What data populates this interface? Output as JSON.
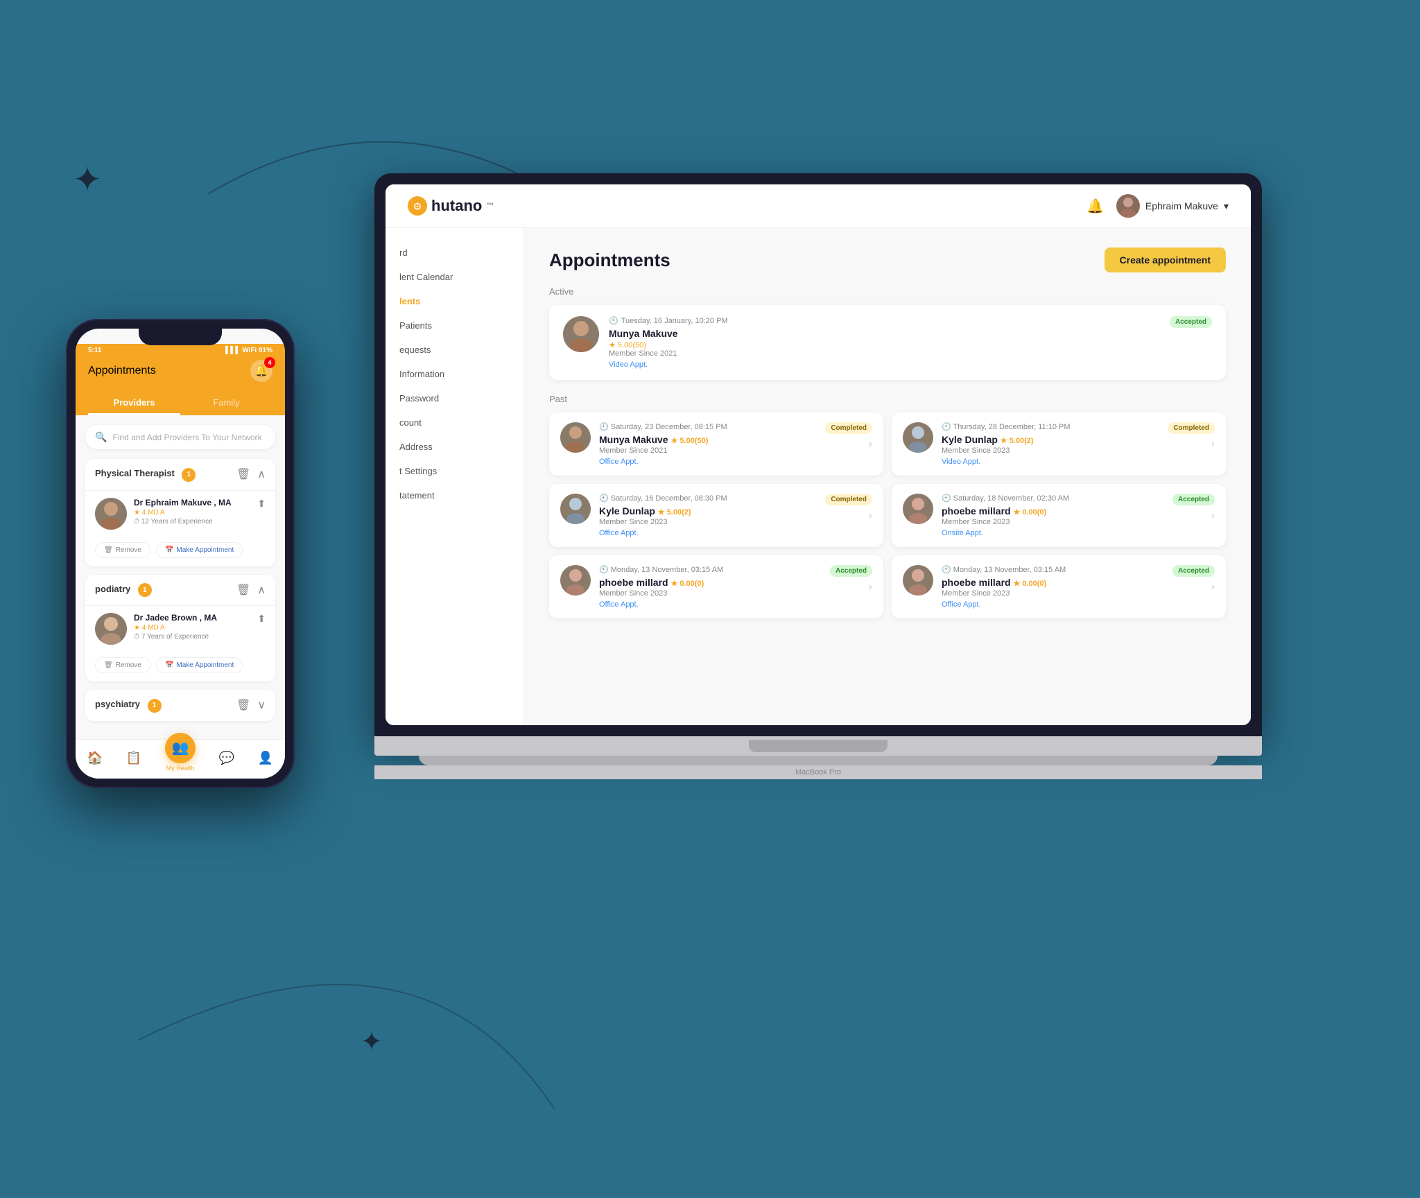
{
  "background": {
    "color": "#2a7a8a"
  },
  "laptop": {
    "nav": {
      "logo_text": "hutano",
      "logo_tm": "™",
      "user_name": "Ephraim Makuve",
      "chevron": "▾"
    },
    "sidebar": {
      "items": [
        {
          "label": "rd",
          "active": false
        },
        {
          "label": "lent Calendar",
          "active": false
        },
        {
          "label": "lents",
          "active": true
        },
        {
          "label": "Patients",
          "active": false
        },
        {
          "label": "equests",
          "active": false
        },
        {
          "label": "Information",
          "active": false
        },
        {
          "label": "Password",
          "active": false
        },
        {
          "label": "count",
          "active": false
        },
        {
          "label": "Address",
          "active": false
        },
        {
          "label": "t Settings",
          "active": false
        },
        {
          "label": "tatement",
          "active": false
        }
      ]
    },
    "main": {
      "title": "Appointments",
      "create_btn": "Create appointment",
      "active_section": "Active",
      "past_section": "Past",
      "active_appointment": {
        "time": "Tuesday, 16 January, 10:20 PM",
        "name": "Munya Makuve",
        "rating": "★ 5.00(50)",
        "member_since": "Member Since 2021",
        "appt_type": "Video Appt.",
        "status": "Accepted"
      },
      "past_appointments": [
        {
          "date": "Saturday, 23 December, 08:15 PM",
          "name": "Munya Makuve",
          "rating": "★ 5.00(50)",
          "member_since": "Member Since 2021",
          "appt_type": "Office Appt.",
          "status": "Completed"
        },
        {
          "date": "Thursday, 28 December, 11:10 PM",
          "name": "Kyle Dunlap",
          "rating": "★ 5.00(2)",
          "member_since": "Member Since 2023",
          "appt_type": "Video Appt.",
          "status": "Completed"
        },
        {
          "date": "Saturday, 16 December, 08:30 PM",
          "name": "Kyle Dunlap",
          "rating": "★ 5.00(2)",
          "member_since": "Member Since 2023",
          "appt_type": "Office Appt.",
          "status": "Completed"
        },
        {
          "date": "Saturday, 18 November, 02:30 AM",
          "name": "phoebe millard",
          "rating": "★ 0.00(0)",
          "member_since": "Member Since 2023",
          "appt_type": "Onsite Appt.",
          "status": "Accepted"
        },
        {
          "date": "Monday, 13 November, 03:15 AM",
          "name": "phoebe millard",
          "rating": "★ 0.00(0)",
          "member_since": "Member Since 2023",
          "appt_type": "Office Appt.",
          "status": "Accepted"
        },
        {
          "date": "Monday, 13 November, 03:15 AM",
          "name": "phoebe millard",
          "rating": "★ 0.00(0)",
          "member_since": "Member Since 2023",
          "appt_type": "Office Appt.",
          "status": "Accepted"
        }
      ]
    }
  },
  "phone": {
    "status_bar": {
      "time": "5:11",
      "signal": "▌▌▌",
      "wifi": "WiFi",
      "battery": "91%"
    },
    "header": {
      "title": "Appointments",
      "bell_count": "4"
    },
    "tabs": [
      {
        "label": "Providers",
        "active": true
      },
      {
        "label": "Family",
        "active": false
      }
    ],
    "search": {
      "placeholder": "Find and Add Providers To Your Network"
    },
    "categories": [
      {
        "title": "Physical Therapist",
        "count": "1",
        "providers": [
          {
            "name": "Dr Ephraim Makuve , MA",
            "credential": "★ 4  MD A",
            "experience": "12 Years of Experience"
          }
        ]
      },
      {
        "title": "podiatry",
        "count": "1",
        "providers": [
          {
            "name": "Dr Jadee Brown , MA",
            "credential": "★ 4  MD A",
            "experience": "7 Years of Experience"
          }
        ]
      },
      {
        "title": "psychiatry",
        "count": "1",
        "collapsed": true
      }
    ],
    "actions": {
      "remove": "Remove",
      "make_appointment": "Make Appointment"
    },
    "bottom_nav": [
      {
        "icon": "🏠",
        "label": "",
        "active": false
      },
      {
        "icon": "📋",
        "label": "",
        "active": false
      },
      {
        "icon": "👥",
        "label": "My Health",
        "active": true,
        "circle": true
      },
      {
        "icon": "💬",
        "label": "",
        "active": false
      },
      {
        "icon": "👤",
        "label": "",
        "active": false
      }
    ]
  }
}
